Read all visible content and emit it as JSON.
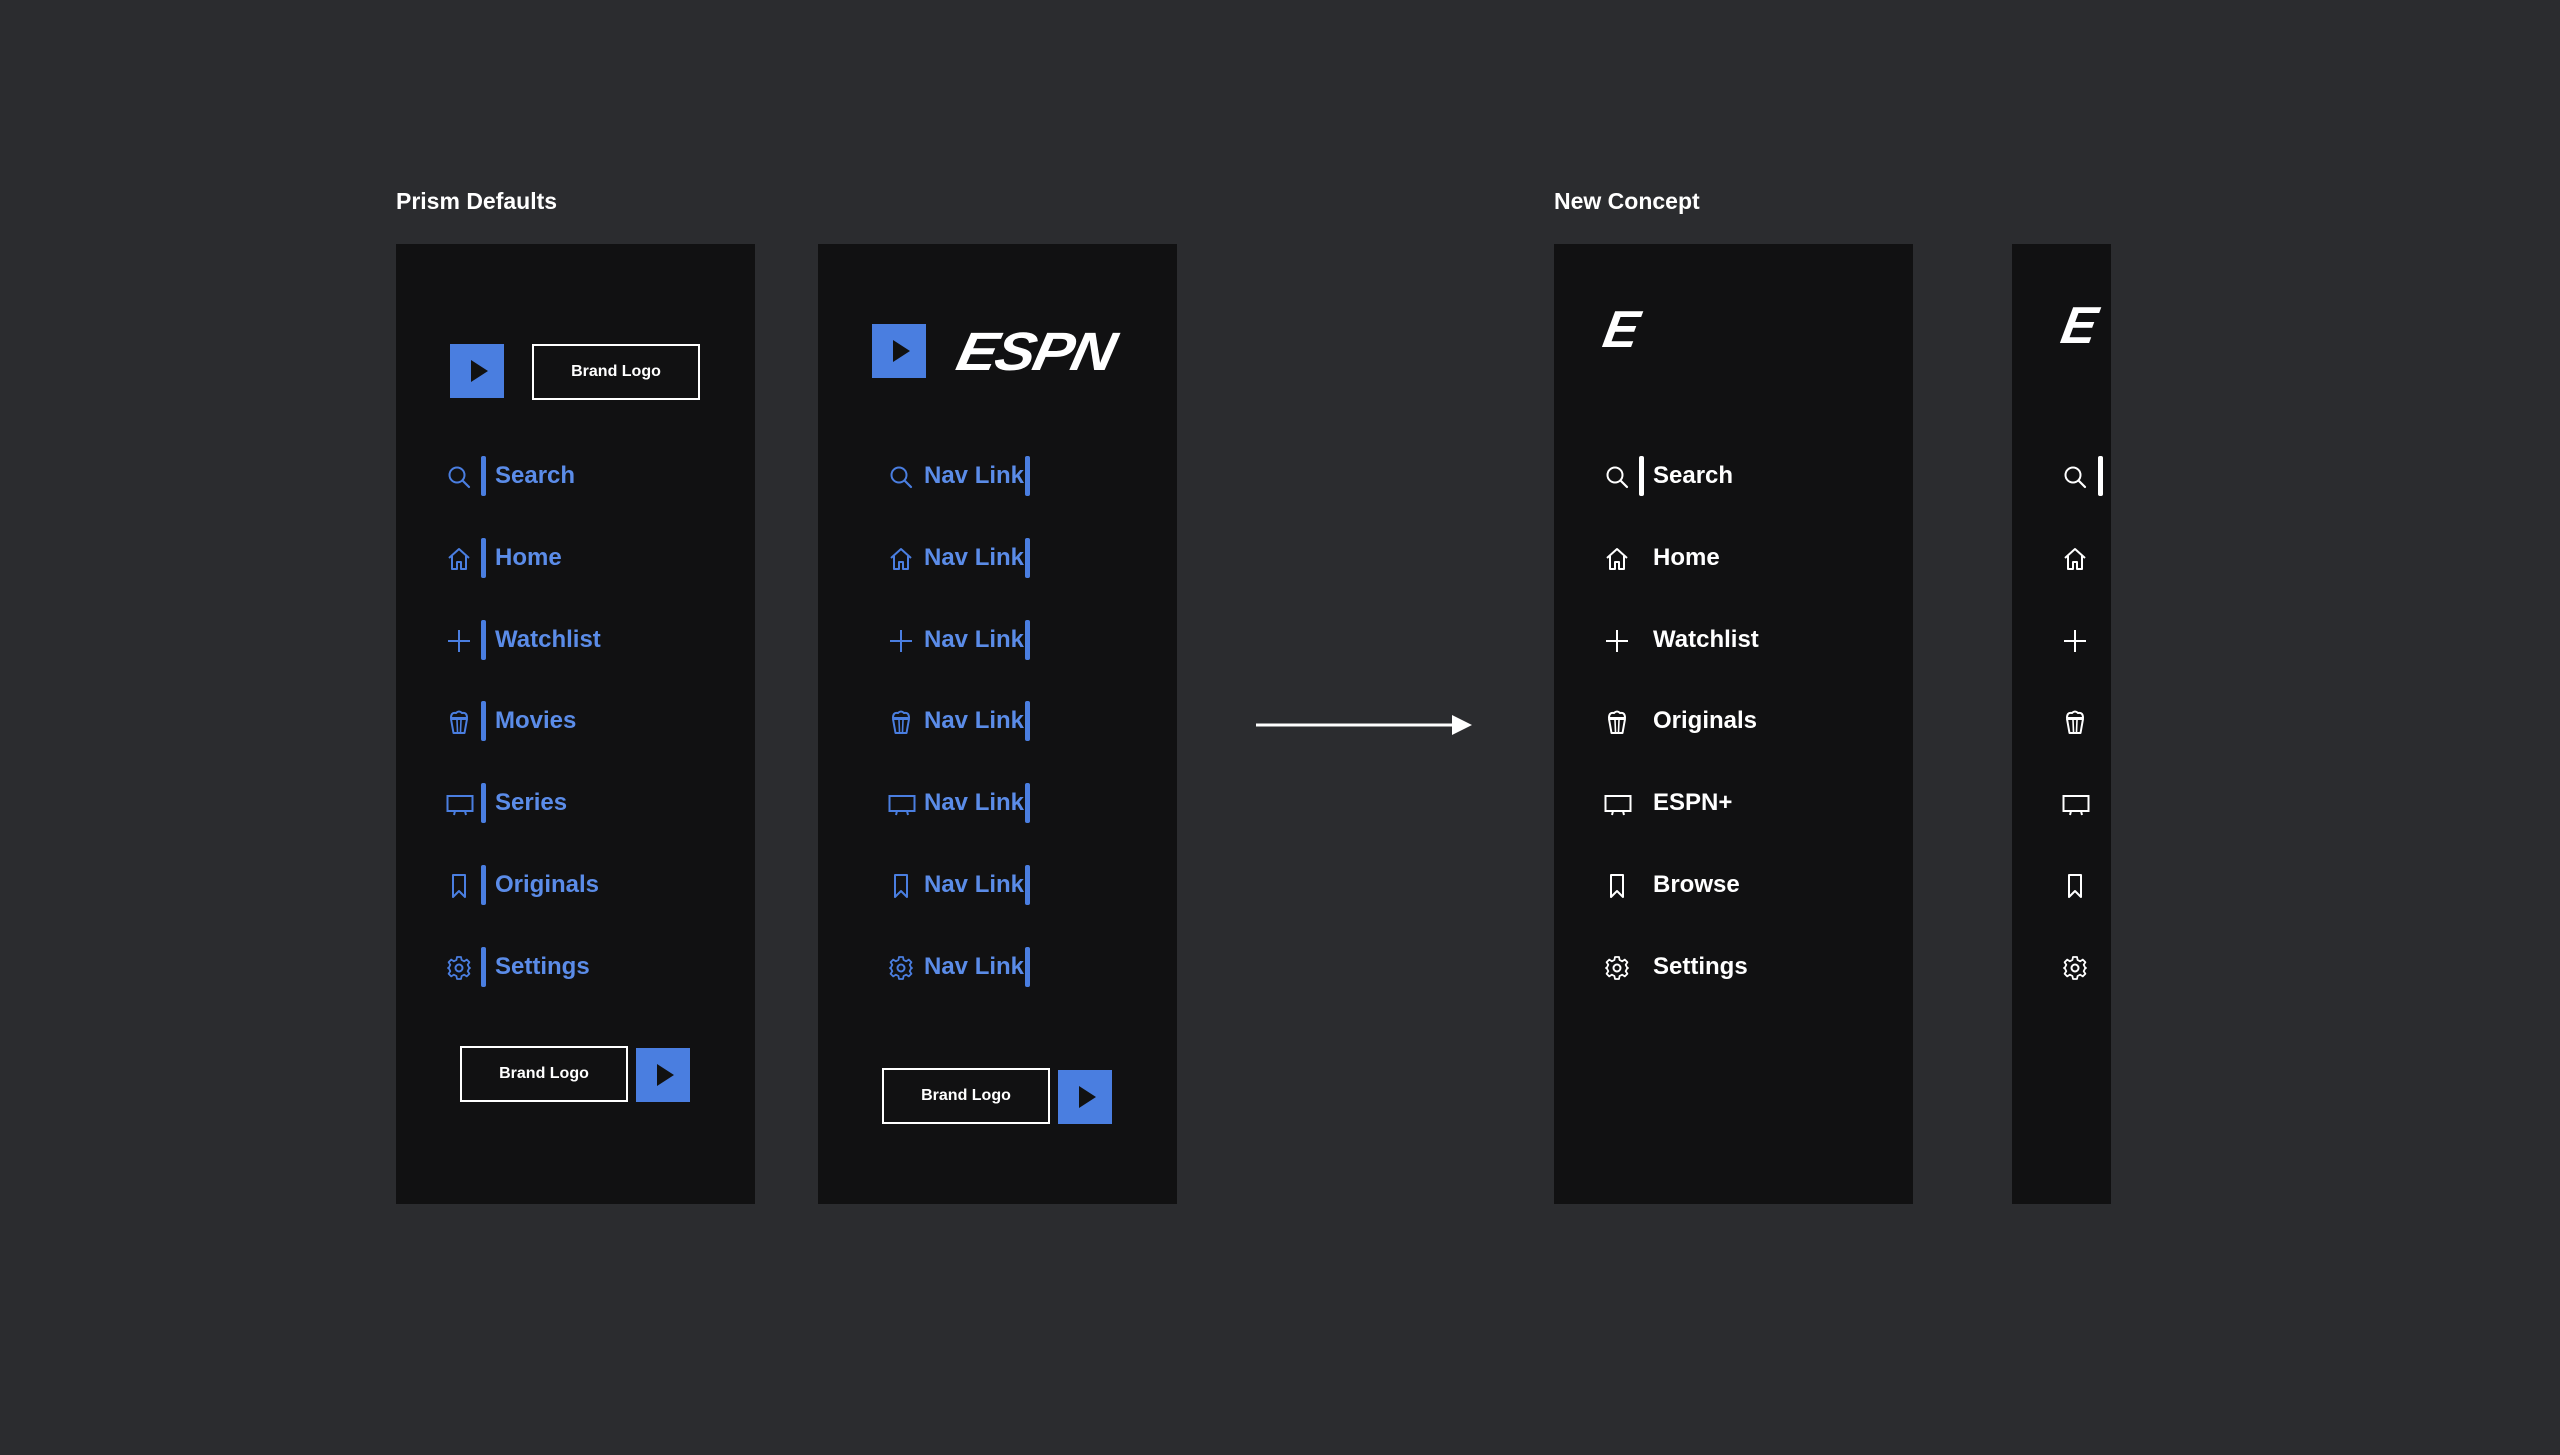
{
  "sections": {
    "prism_title": "Prism Defaults",
    "concept_title": "New Concept"
  },
  "colors": {
    "background": "#2b2c2f",
    "panel": "#111112",
    "accent_blue": "#4a7ee0",
    "text_blue": "#5b8ce8",
    "white": "#ffffff"
  },
  "panel1": {
    "brand_logo_top": "Brand Logo",
    "brand_logo_bottom": "Brand Logo",
    "nav": [
      {
        "label": "Search",
        "icon": "search-icon"
      },
      {
        "label": "Home",
        "icon": "home-icon"
      },
      {
        "label": "Watchlist",
        "icon": "plus-icon"
      },
      {
        "label": "Movies",
        "icon": "popcorn-icon"
      },
      {
        "label": "Series",
        "icon": "tv-icon"
      },
      {
        "label": "Originals",
        "icon": "bookmark-icon"
      },
      {
        "label": "Settings",
        "icon": "gear-icon"
      }
    ]
  },
  "panel2": {
    "logo_text": "ESPN",
    "brand_logo_bottom": "Brand Logo",
    "nav": [
      {
        "label": "Nav Link",
        "icon": "search-icon"
      },
      {
        "label": "Nav Link",
        "icon": "home-icon"
      },
      {
        "label": "Nav Link",
        "icon": "plus-icon"
      },
      {
        "label": "Nav Link",
        "icon": "popcorn-icon"
      },
      {
        "label": "Nav Link",
        "icon": "tv-icon"
      },
      {
        "label": "Nav Link",
        "icon": "bookmark-icon"
      },
      {
        "label": "Nav Link",
        "icon": "gear-icon"
      }
    ]
  },
  "panel3": {
    "logo_text": "E",
    "nav": [
      {
        "label": "Search",
        "icon": "search-icon"
      },
      {
        "label": "Home",
        "icon": "home-icon"
      },
      {
        "label": "Watchlist",
        "icon": "plus-icon"
      },
      {
        "label": "Originals",
        "icon": "popcorn-icon"
      },
      {
        "label": "ESPN+",
        "icon": "tv-icon"
      },
      {
        "label": "Browse",
        "icon": "bookmark-icon"
      },
      {
        "label": "Settings",
        "icon": "gear-icon"
      }
    ]
  },
  "panel4": {
    "logo_text": "E",
    "nav": [
      {
        "icon": "search-icon"
      },
      {
        "icon": "home-icon"
      },
      {
        "icon": "plus-icon"
      },
      {
        "icon": "popcorn-icon"
      },
      {
        "icon": "tv-icon"
      },
      {
        "icon": "bookmark-icon"
      },
      {
        "icon": "gear-icon"
      }
    ]
  }
}
